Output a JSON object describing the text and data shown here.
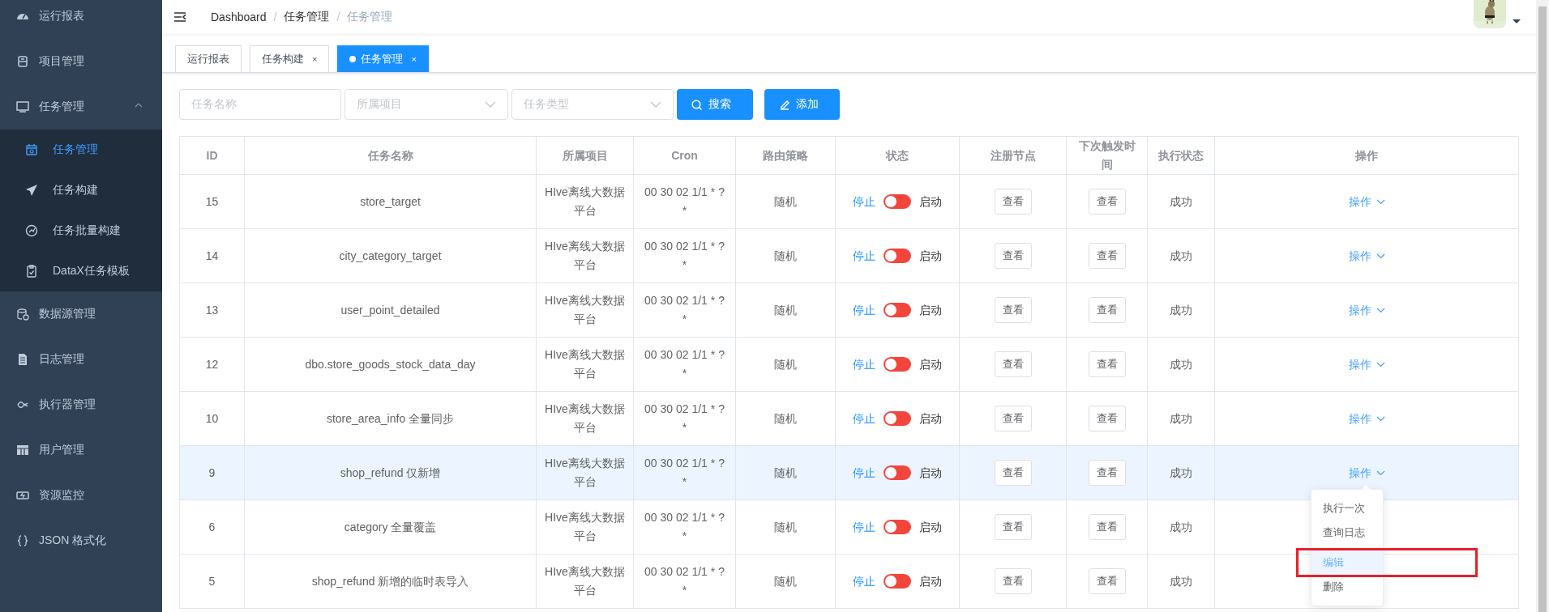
{
  "sidebar": {
    "items": [
      {
        "label": "运行报表",
        "selected": false
      },
      {
        "label": "项目管理",
        "selected": false
      },
      {
        "label": "任务管理",
        "selected": false,
        "expanded": true,
        "children": [
          {
            "label": "任务管理",
            "selected": true
          },
          {
            "label": "任务构建",
            "selected": false
          },
          {
            "label": "任务批量构建",
            "selected": false
          },
          {
            "label": "DataX任务模板",
            "selected": false
          }
        ]
      },
      {
        "label": "数据源管理",
        "selected": false
      },
      {
        "label": "日志管理",
        "selected": false
      },
      {
        "label": "执行器管理",
        "selected": false
      },
      {
        "label": "用户管理",
        "selected": false
      },
      {
        "label": "资源监控",
        "selected": false
      },
      {
        "label": "JSON 格式化",
        "selected": false
      }
    ]
  },
  "header": {
    "breadcrumb": [
      "Dashboard",
      "任务管理",
      "任务管理"
    ],
    "separator": "/"
  },
  "tabs": [
    {
      "label": "运行报表",
      "selected": false
    },
    {
      "label": "任务构建",
      "selected": false,
      "close": "×"
    },
    {
      "label": "任务管理",
      "selected": true,
      "close": "×"
    }
  ],
  "filters": {
    "name": {
      "placeholder": "任务名称"
    },
    "project": {
      "placeholder": "所属项目"
    },
    "type": {
      "placeholder": "任务类型"
    },
    "search_button": "搜索",
    "add_button": "添加"
  },
  "table": {
    "columns": [
      "ID",
      "任务名称",
      "所属项目",
      "Cron",
      "路由策略",
      "状态",
      "注册节点",
      "下次触发时间",
      "执行状态",
      "操作"
    ],
    "rows": [
      {
        "id": "15",
        "name": "store_target",
        "project": "HIve离线大数据平台",
        "cron": "00 30 02 1/1 * ? *",
        "route": "随机",
        "stop": "停止",
        "on": false,
        "start": "启动",
        "node_button": "查看",
        "next_button": "查看",
        "exec_status": "成功",
        "action": "操作",
        "highlighted": false
      },
      {
        "id": "14",
        "name": "city_category_target",
        "project": "HIve离线大数据平台",
        "cron": "00 30 02 1/1 * ? *",
        "route": "随机",
        "stop": "停止",
        "on": false,
        "start": "启动",
        "node_button": "查看",
        "next_button": "查看",
        "exec_status": "成功",
        "action": "操作",
        "highlighted": false
      },
      {
        "id": "13",
        "name": "user_point_detailed",
        "project": "HIve离线大数据平台",
        "cron": "00 30 02 1/1 * ? *",
        "route": "随机",
        "stop": "停止",
        "on": false,
        "start": "启动",
        "node_button": "查看",
        "next_button": "查看",
        "exec_status": "成功",
        "action": "操作",
        "highlighted": false
      },
      {
        "id": "12",
        "name": "dbo.store_goods_stock_data_day",
        "project": "HIve离线大数据平台",
        "cron": "00 30 02 1/1 * ? *",
        "route": "随机",
        "stop": "停止",
        "on": false,
        "start": "启动",
        "node_button": "查看",
        "next_button": "查看",
        "exec_status": "成功",
        "action": "操作",
        "highlighted": false
      },
      {
        "id": "10",
        "name": "store_area_info 全量同步",
        "project": "HIve离线大数据平台",
        "cron": "00 30 02 1/1 * ? *",
        "route": "随机",
        "stop": "停止",
        "on": false,
        "start": "启动",
        "node_button": "查看",
        "next_button": "查看",
        "exec_status": "成功",
        "action": "操作",
        "highlighted": false
      },
      {
        "id": "9",
        "name": "shop_refund 仅新增",
        "project": "HIve离线大数据平台",
        "cron": "00 30 02 1/1 * ? *",
        "route": "随机",
        "stop": "停止",
        "on": false,
        "start": "启动",
        "node_button": "查看",
        "next_button": "查看",
        "exec_status": "成功",
        "action": "操作",
        "highlighted": true
      },
      {
        "id": "6",
        "name": "category 全量覆盖",
        "project": "HIve离线大数据平台",
        "cron": "00 30 02 1/1 * ? *",
        "route": "随机",
        "stop": "停止",
        "on": false,
        "start": "启动",
        "node_button": "查看",
        "next_button": "查看",
        "exec_status": "成功",
        "highlighted": false
      },
      {
        "id": "5",
        "name": "shop_refund 新增的临时表导入",
        "project": "HIve离线大数据平台",
        "cron": "00 30 02 1/1 * ? *",
        "route": "随机",
        "stop": "停止",
        "on": false,
        "start": "启动",
        "node_button": "查看",
        "next_button": "查看",
        "exec_status": "成功",
        "highlighted": false
      }
    ]
  },
  "action_menu": {
    "items": [
      {
        "label": "执行一次",
        "highlighted": false,
        "divided": false
      },
      {
        "label": "查询日志",
        "highlighted": false,
        "divided": false
      },
      {
        "label": "编辑",
        "highlighted": true,
        "divided": true
      },
      {
        "label": "删除",
        "highlighted": false,
        "divided": false
      }
    ]
  }
}
